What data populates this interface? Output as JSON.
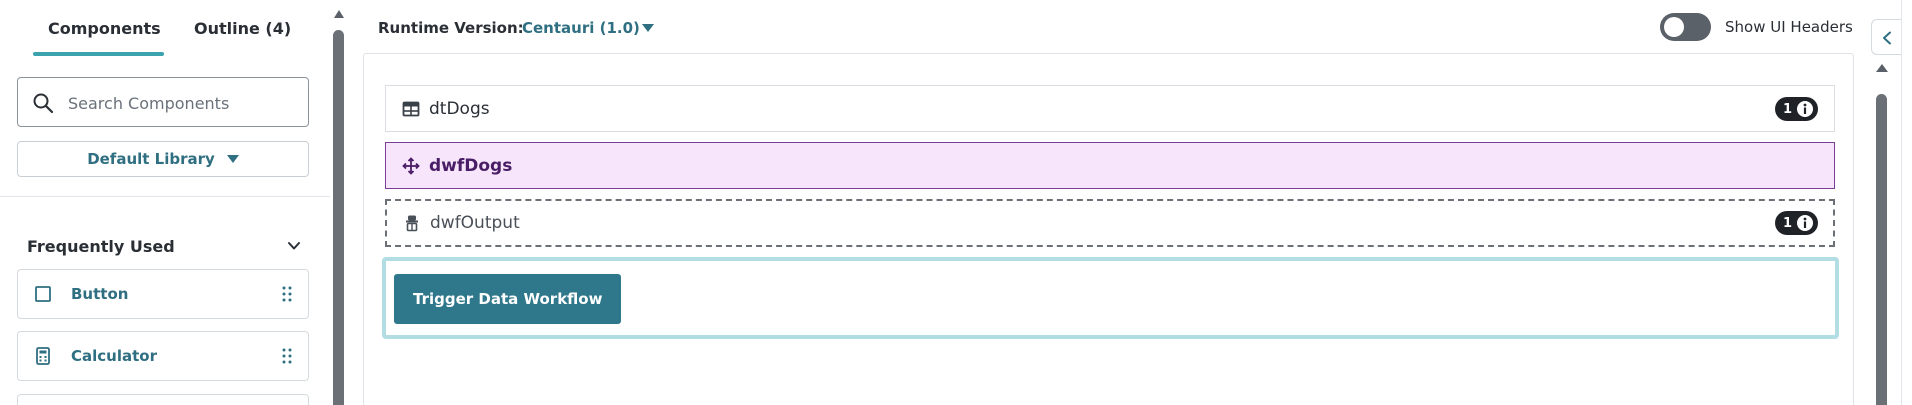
{
  "sidebar": {
    "tabs": [
      {
        "label": "Components",
        "active": true
      },
      {
        "label": "Outline (4)",
        "active": false
      }
    ],
    "search": {
      "value": "",
      "placeholder": "Search Components",
      "icon": "search-icon"
    },
    "library": {
      "label": "Default Library",
      "icon": "caret-down-icon"
    },
    "section": {
      "title": "Frequently Used",
      "icon": "chevron-down-icon"
    },
    "items": [
      {
        "label": "Button",
        "icon": "square-icon"
      },
      {
        "label": "Calculator",
        "icon": "calculator-icon"
      }
    ]
  },
  "topbar": {
    "runtime_label": "Runtime Version:",
    "runtime_value": "Centauri (1.0)",
    "toggle_label": "Show UI Headers",
    "toggle_on": false
  },
  "canvas": {
    "rows": [
      {
        "label": "dtDogs",
        "icon": "table-icon",
        "badge": "1"
      },
      {
        "label": "dwfDogs",
        "icon": "move-icon",
        "selected": true
      },
      {
        "label": "dwfOutput",
        "icon": "agent-icon",
        "badge": "1"
      }
    ],
    "button_label": "Trigger Data Workflow"
  },
  "colors": {
    "accent": "#3aa3ad",
    "link": "#2f6f81",
    "button": "#2f788c",
    "selected_bg": "#f7e6fb",
    "selected_border": "#7b3f96",
    "container_border": "#b2dde2"
  }
}
